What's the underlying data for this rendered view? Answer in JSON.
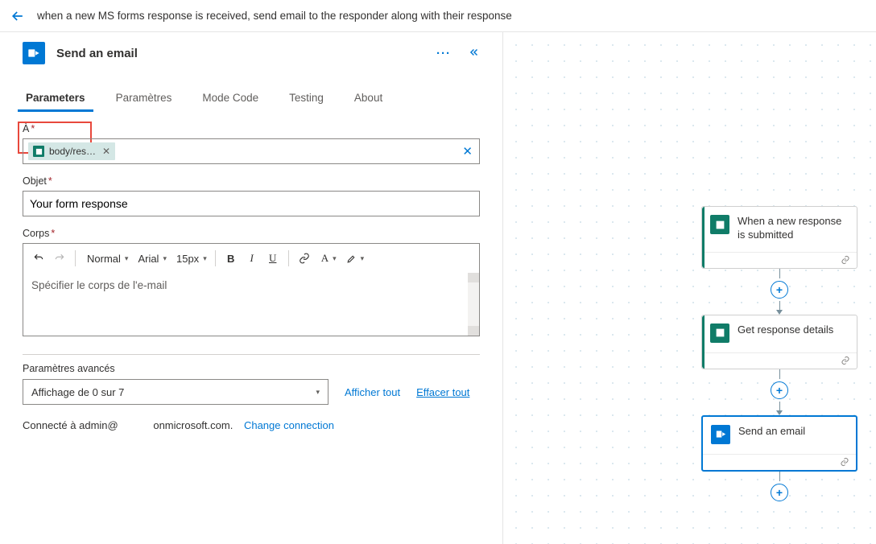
{
  "header": {
    "flow_title": "when a new MS forms response is received, send email to the responder along with their response"
  },
  "panel": {
    "title": "Send an email"
  },
  "tabs": [
    "Parameters",
    "Paramètres",
    "Mode Code",
    "Testing",
    "About"
  ],
  "form": {
    "to_label": "À",
    "to_token": "body/res…",
    "subject_label": "Objet",
    "subject_value": "Your form response",
    "body_label": "Corps",
    "body_placeholder": "Spécifier le corps de l'e-mail",
    "tb_style": "Normal",
    "tb_font": "Arial",
    "tb_size": "15px"
  },
  "advanced": {
    "label": "Paramètres avancés",
    "select_text": "Affichage de 0 sur 7",
    "show_all": "Afficher tout",
    "clear_all": "Effacer tout"
  },
  "connection": {
    "prefix": "Connecté à admin@",
    "domain": "onmicrosoft.com.",
    "change": "Change connection"
  },
  "nodes": {
    "trigger": "When a new response is submitted",
    "get_details": "Get response details",
    "send_email": "Send an email"
  }
}
